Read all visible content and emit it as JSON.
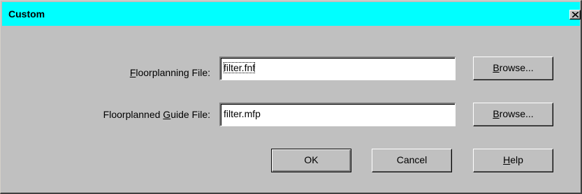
{
  "window": {
    "title": "Custom",
    "close_glyph": "×"
  },
  "floorplanning_file": {
    "label_pre": "",
    "label_mnemonic": "F",
    "label_post": "loorplanning File:",
    "value": "filter.fnf",
    "browse_mnemonic": "B",
    "browse_rest": "rowse..."
  },
  "guide_file": {
    "label_pre": "Floorplanned ",
    "label_mnemonic": "G",
    "label_post": "uide File:",
    "value": "filter.mfp",
    "browse_mnemonic": "B",
    "browse_rest": "rowse..."
  },
  "buttons": {
    "ok": "OK",
    "cancel": "Cancel",
    "help_mnemonic": "H",
    "help_rest": "elp"
  },
  "colors": {
    "titlebar": "#00ffff",
    "dialog_face": "#c0c0c0"
  }
}
